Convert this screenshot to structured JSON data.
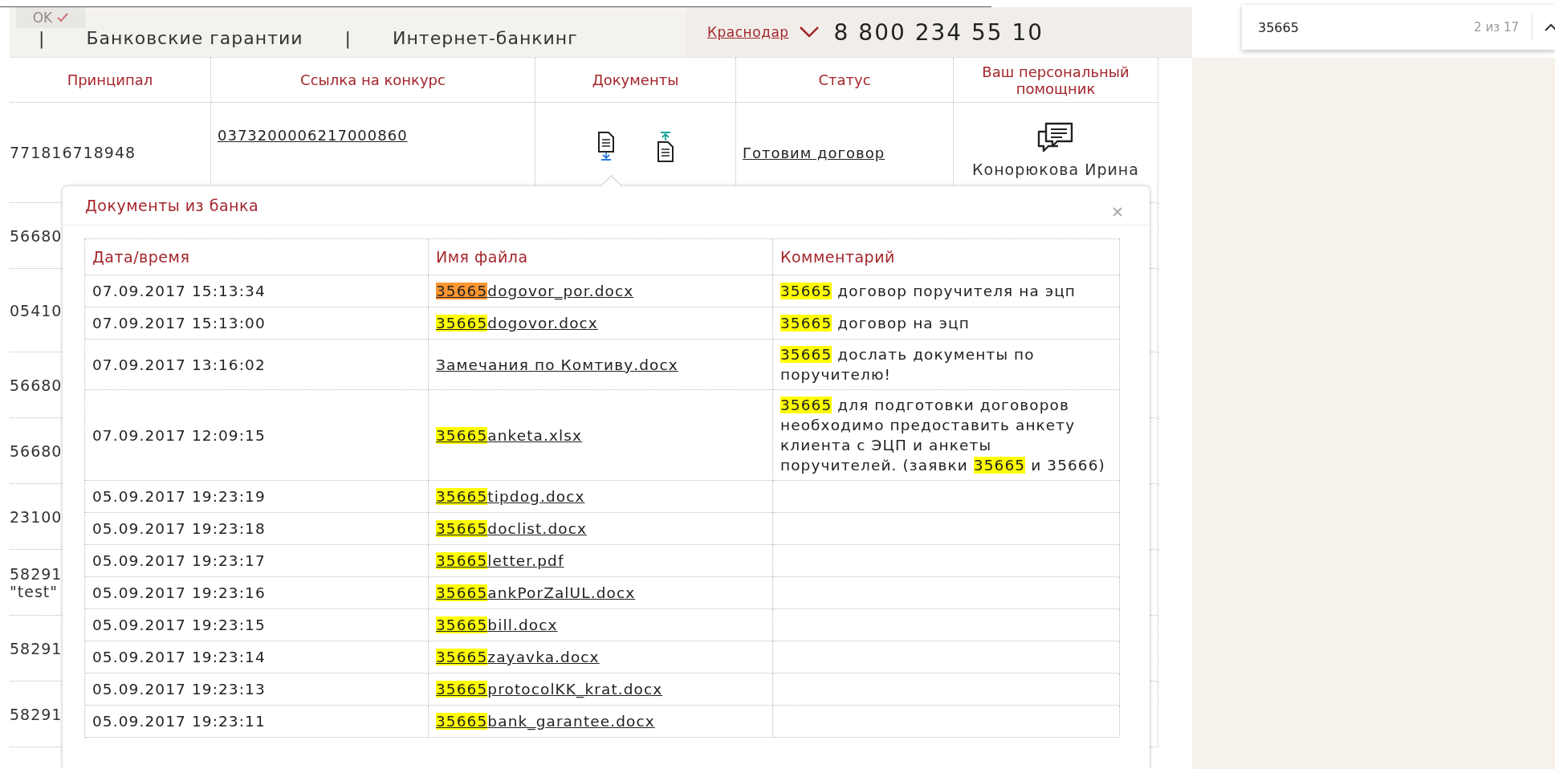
{
  "top_bar": {
    "ok_button": {
      "label": "OK",
      "disabled": true
    },
    "nav": [
      {
        "kind": "separator",
        "text": "|"
      },
      {
        "kind": "link",
        "text": "Банковские гарантии"
      },
      {
        "kind": "separator",
        "text": "|"
      },
      {
        "kind": "link",
        "text": "Интернет-банкинг"
      }
    ],
    "city": "Краснодар",
    "phone": "8 800 234 55 10"
  },
  "find_bar": {
    "query": "35665",
    "count": "2 из 17"
  },
  "table": {
    "columns": [
      "Принципал",
      "Ссылка на конкурс",
      "Документы",
      "Статус",
      "Ваш персональный помощник"
    ],
    "main_row": {
      "principal": "771816718948",
      "tender_link": "0373200006217000860",
      "status": "Готовим договор",
      "assistant": "Конорюкова Ирина"
    },
    "rows": [
      {
        "principal": "56680"
      },
      {
        "principal": "05410"
      },
      {
        "principal": "56680"
      },
      {
        "principal": "56680"
      },
      {
        "principal": "23100"
      },
      {
        "principal": "58291",
        "note": "\"test\""
      },
      {
        "principal": "58291"
      },
      {
        "principal": "58291"
      }
    ]
  },
  "popup": {
    "title": "Документы из банка",
    "columns": [
      "Дата/время",
      "Имя файла",
      "Комментарий"
    ],
    "rows": [
      {
        "datetime": "07.09.2017 15:13:34",
        "file": [
          {
            "text": "35665",
            "highlighted": true,
            "current": true
          },
          {
            "text": "dogovor_por.docx",
            "highlighted": false,
            "current": false
          }
        ],
        "comment": [
          {
            "text": "35665",
            "highlighted": true,
            "current": false
          },
          {
            "text": " договор поручителя на эцп",
            "highlighted": false,
            "current": false
          }
        ]
      },
      {
        "datetime": "07.09.2017 15:13:00",
        "file": [
          {
            "text": "35665",
            "highlighted": true,
            "current": false
          },
          {
            "text": "dogovor.docx",
            "highlighted": false,
            "current": false
          }
        ],
        "comment": [
          {
            "text": "35665",
            "highlighted": true,
            "current": false
          },
          {
            "text": " договор на эцп",
            "highlighted": false,
            "current": false
          }
        ]
      },
      {
        "datetime": "07.09.2017 13:16:02",
        "file": [
          {
            "text": "Замечания по Комтиву.docx",
            "highlighted": false,
            "current": false
          }
        ],
        "comment": [
          {
            "text": "35665",
            "highlighted": true,
            "current": false
          },
          {
            "text": " дослать документы по поручителю!",
            "highlighted": false,
            "current": false
          }
        ]
      },
      {
        "datetime": "07.09.2017 12:09:15",
        "file": [
          {
            "text": "35665",
            "highlighted": true,
            "current": false
          },
          {
            "text": "anketa.xlsx",
            "highlighted": false,
            "current": false
          }
        ],
        "comment": [
          {
            "text": "35665",
            "highlighted": true,
            "current": false
          },
          {
            "text": " для подготовки договоров необходимо предоставить анкету клиента с ЭЦП и анкеты поручителей. (заявки ",
            "highlighted": false,
            "current": false
          },
          {
            "text": "35665",
            "highlighted": true,
            "current": false
          },
          {
            "text": " и 35666)",
            "highlighted": false,
            "current": false
          }
        ]
      },
      {
        "datetime": "05.09.2017 19:23:19",
        "file": [
          {
            "text": "35665",
            "highlighted": true,
            "current": false
          },
          {
            "text": "tipdog.docx",
            "highlighted": false,
            "current": false
          }
        ]
      },
      {
        "datetime": "05.09.2017 19:23:18",
        "file": [
          {
            "text": "35665",
            "highlighted": true,
            "current": false
          },
          {
            "text": "doclist.docx",
            "highlighted": false,
            "current": false
          }
        ]
      },
      {
        "datetime": "05.09.2017 19:23:17",
        "file": [
          {
            "text": "35665",
            "highlighted": true,
            "current": false
          },
          {
            "text": "letter.pdf",
            "highlighted": false,
            "current": false
          }
        ]
      },
      {
        "datetime": "05.09.2017 19:23:16",
        "file": [
          {
            "text": "35665",
            "highlighted": true,
            "current": false
          },
          {
            "text": "ankPorZalUL.docx",
            "highlighted": false,
            "current": false
          }
        ]
      },
      {
        "datetime": "05.09.2017 19:23:15",
        "file": [
          {
            "text": "35665",
            "highlighted": true,
            "current": false
          },
          {
            "text": "bill.docx",
            "highlighted": false,
            "current": false
          }
        ]
      },
      {
        "datetime": "05.09.2017 19:23:14",
        "file": [
          {
            "text": "35665",
            "highlighted": true,
            "current": false
          },
          {
            "text": "zayavka.docx",
            "highlighted": false,
            "current": false
          }
        ]
      },
      {
        "datetime": "05.09.2017 19:23:13",
        "file": [
          {
            "text": "35665",
            "highlighted": true,
            "current": false
          },
          {
            "text": "protocolKK_krat.docx",
            "highlighted": false,
            "current": false
          }
        ]
      },
      {
        "datetime": "05.09.2017 19:23:11",
        "file": [
          {
            "text": "35665",
            "highlighted": true,
            "current": false
          },
          {
            "text": "bank_garantee.docx",
            "highlighted": false,
            "current": false
          }
        ]
      }
    ]
  }
}
